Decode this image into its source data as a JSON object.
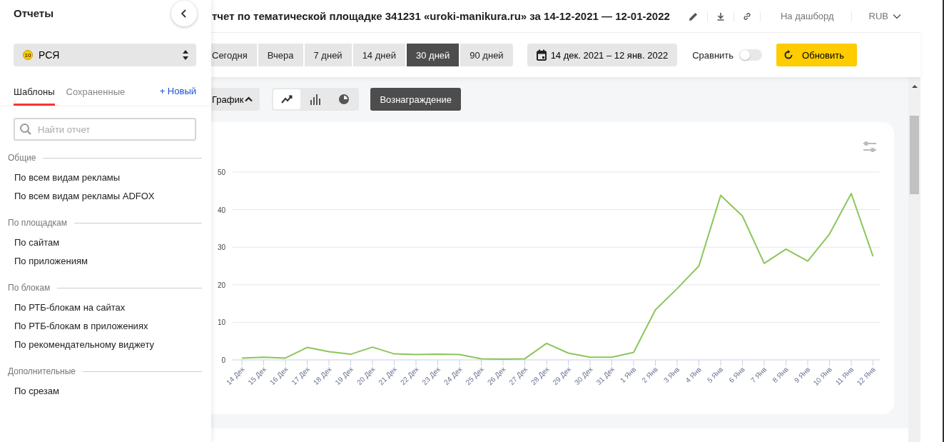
{
  "sidebar": {
    "title": "Отчеты",
    "source": {
      "badge": "10",
      "label": "РСЯ"
    },
    "tabs": [
      {
        "label": "Шаблоны",
        "selected": true
      },
      {
        "label": "Сохраненные",
        "selected": false
      }
    ],
    "new_link": "+ Новый",
    "search": {
      "placeholder": "Найти отчет"
    },
    "groups": [
      {
        "title": "Общие",
        "items": [
          "По всем видам рекламы",
          "По всем видам рекламы ADFOX"
        ]
      },
      {
        "title": "По площадкам",
        "items": [
          "По сайтам",
          "По приложениям"
        ]
      },
      {
        "title": "По блокам",
        "items": [
          "По РТБ-блокам на сайтах",
          "По РТБ-блокам в приложениях",
          "По рекомендательному виджету"
        ]
      },
      {
        "title": "Дополнительные",
        "items": [
          "По срезам"
        ]
      }
    ]
  },
  "header": {
    "title": "тчет по тематической площадке 341231 «uroki-manikura.ru» за 14-12-2021 — 12-01-2022",
    "dashboard_link": "На дашборд",
    "currency": "RUB"
  },
  "toolbar": {
    "periods": [
      {
        "label": "Сегодня",
        "selected": false
      },
      {
        "label": "Вчера",
        "selected": false
      },
      {
        "label": "7 дней",
        "selected": false
      },
      {
        "label": "14 дней",
        "selected": false
      },
      {
        "label": "30 дней",
        "selected": true
      },
      {
        "label": "90 дней",
        "selected": false
      }
    ],
    "date_range": "14 дек. 2021 – 12 янв. 2022",
    "compare": {
      "label": "Сравнить",
      "on": false
    },
    "refresh_button": "Обновить"
  },
  "content": {
    "view_toggle": {
      "label": "График",
      "expanded": true
    },
    "chart_types": [
      {
        "kind": "line",
        "selected": true
      },
      {
        "kind": "bar",
        "selected": false
      },
      {
        "kind": "pie",
        "selected": false
      }
    ],
    "metric_button": "Вознаграждение",
    "chart_data": {
      "type": "line",
      "categories": [
        "14 Дек",
        "15 Дек",
        "16 Дек",
        "17 Дек",
        "18 Дек",
        "19 Дек",
        "20 Дек",
        "21 Дек",
        "22 Дек",
        "23 Дек",
        "24 Дек",
        "25 Дек",
        "26 Дек",
        "27 Дек",
        "28 Дек",
        "29 Дек",
        "30 Дек",
        "31 Дек",
        "1 Янв",
        "2 Янв",
        "3 Янв",
        "4 Янв",
        "5 Янв",
        "6 Янв",
        "7 Янв",
        "8 Янв",
        "9 Янв",
        "10 Янв",
        "11 Янв",
        "12 Янв"
      ],
      "series": [
        {
          "color": "#8cc65a",
          "values": [
            0.5,
            0.7,
            0.5,
            3.3,
            2.2,
            1.5,
            3.4,
            1.6,
            1.4,
            1.5,
            1.4,
            0.3,
            0.2,
            0.3,
            4.4,
            1.8,
            0.7,
            0.7,
            2.0,
            13.3,
            19.0,
            25.0,
            43.8,
            38.3,
            25.7,
            29.5,
            26.3,
            33.5,
            44.3,
            27.6
          ]
        }
      ],
      "ylim": [
        0,
        50
      ],
      "grid": true,
      "yticks": [
        0,
        10,
        20,
        30,
        40,
        50
      ]
    }
  }
}
